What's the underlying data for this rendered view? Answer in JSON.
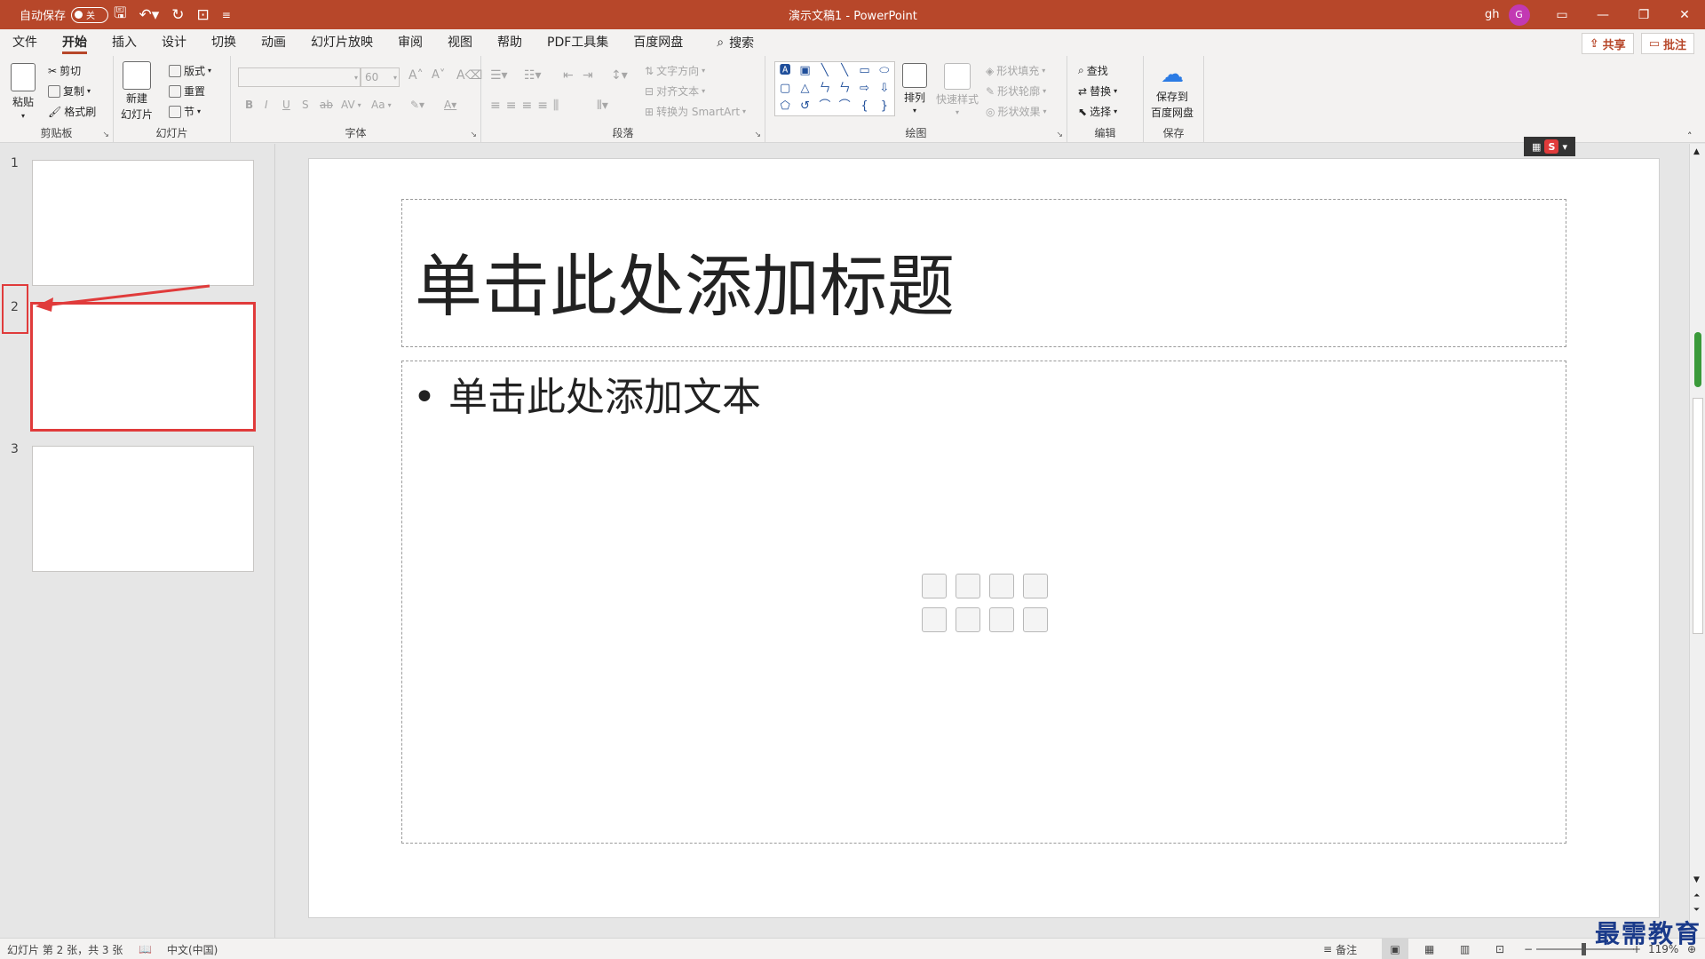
{
  "titlebar": {
    "autosave_label": "自动保存",
    "autosave_state": "关",
    "doc_title": "演示文稿1 - PowerPoint",
    "user": "gh",
    "avatar_initial": "G"
  },
  "menu": {
    "tabs": [
      "文件",
      "开始",
      "插入",
      "设计",
      "切换",
      "动画",
      "幻灯片放映",
      "审阅",
      "视图",
      "帮助",
      "PDF工具集",
      "百度网盘"
    ],
    "active_tab": "开始",
    "search_label": "搜索",
    "share_label": "共享",
    "comment_label": "批注"
  },
  "ribbon": {
    "clipboard": {
      "label": "剪贴板",
      "paste": "粘贴",
      "cut": "剪切",
      "copy": "复制",
      "format_painter": "格式刷"
    },
    "slides": {
      "label": "幻灯片",
      "new_slide_line1": "新建",
      "new_slide_line2": "幻灯片",
      "layout": "版式",
      "reset": "重置",
      "section": "节"
    },
    "font": {
      "label": "字体",
      "size": "60",
      "bold": "B",
      "italic": "I",
      "underline": "U",
      "shadow": "S",
      "strike": "ab",
      "spacing": "AV",
      "case": "Aa"
    },
    "paragraph": {
      "label": "段落",
      "text_direction": "文字方向",
      "align_text": "对齐文本",
      "smartart": "转换为 SmartArt"
    },
    "drawing": {
      "label": "绘图",
      "arrange": "排列",
      "quick_styles": "快速样式",
      "shape_fill": "形状填充",
      "shape_outline": "形状轮廓",
      "shape_effects": "形状效果"
    },
    "editing": {
      "label": "编辑",
      "find": "查找",
      "replace": "替换",
      "select": "选择"
    },
    "save": {
      "label": "保存",
      "save_to_line1": "保存到",
      "save_to_line2": "百度网盘"
    }
  },
  "thumbnails": [
    {
      "num": "1"
    },
    {
      "num": "2"
    },
    {
      "num": "3"
    }
  ],
  "selected_slide": "2",
  "slide": {
    "title_placeholder": "单击此处添加标题",
    "body_placeholder": "• 单击此处添加文本"
  },
  "status": {
    "slide_info": "幻灯片 第 2 张，共 3 张",
    "language": "中文(中国)",
    "notes": "备注",
    "zoom": "119%"
  },
  "watermark": "最需教育",
  "colors": {
    "accent": "#b7472a",
    "highlight": "#e03b3b"
  }
}
